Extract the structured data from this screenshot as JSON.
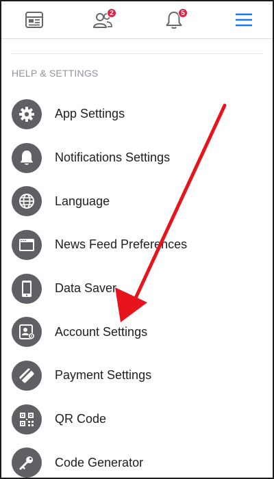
{
  "topnav": {
    "items": [
      {
        "name": "news-feed",
        "icon": "news-feed-icon"
      },
      {
        "name": "friend-requests",
        "icon": "friends-icon",
        "badge": "2"
      },
      {
        "name": "notifications",
        "icon": "bell-icon",
        "badge": "5"
      },
      {
        "name": "menu",
        "icon": "hamburger-icon",
        "active": true
      }
    ]
  },
  "section": {
    "header": "HELP & SETTINGS",
    "items": [
      {
        "label": "App Settings",
        "icon": "gear-icon"
      },
      {
        "label": "Notifications Settings",
        "icon": "bell-icon"
      },
      {
        "label": "Language",
        "icon": "globe-icon"
      },
      {
        "label": "News Feed Preferences",
        "icon": "news-feed-icon"
      },
      {
        "label": "Data Saver",
        "icon": "phone-icon"
      },
      {
        "label": "Account Settings",
        "icon": "account-gear-icon"
      },
      {
        "label": "Payment Settings",
        "icon": "card-icon"
      },
      {
        "label": "QR Code",
        "icon": "qr-code-icon"
      },
      {
        "label": "Code Generator",
        "icon": "key-icon"
      }
    ]
  },
  "colors": {
    "accent": "#1877f2",
    "badge": "#e41e3f",
    "icon_circle": "#5f6063",
    "annotation_arrow": "#e8141c"
  }
}
